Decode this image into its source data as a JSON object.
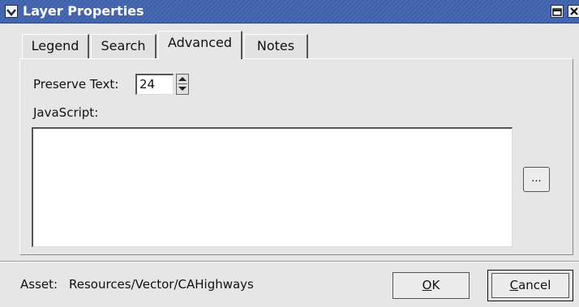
{
  "window": {
    "title": "Layer Properties"
  },
  "tabs": [
    {
      "label": "Legend",
      "active": false
    },
    {
      "label": "Search",
      "active": false
    },
    {
      "label": "Advanced",
      "active": true
    },
    {
      "label": "Notes",
      "active": false
    }
  ],
  "advanced": {
    "preserve_text_label": "Preserve Text:",
    "preserve_text_value": "24",
    "javascript_label": "JavaScript:",
    "javascript_value": "",
    "browse_label": "..."
  },
  "footer": {
    "asset_label": "Asset:",
    "asset_value": "Resources/Vector/CAHighways",
    "ok_label_mnemonic": "O",
    "ok_label_rest": "K",
    "cancel_label_mnemonic": "C",
    "cancel_label_rest": "ancel"
  },
  "icons": {
    "window_menu": "chevron-down-icon",
    "maximize": "maximize-icon",
    "close": "close-icon",
    "spin_up": "arrow-up-icon",
    "spin_down": "arrow-down-icon"
  },
  "colors": {
    "titlebar": "#3e5fa9",
    "title_text": "#ffffff",
    "dialog_bg": "#e6e6e6"
  }
}
